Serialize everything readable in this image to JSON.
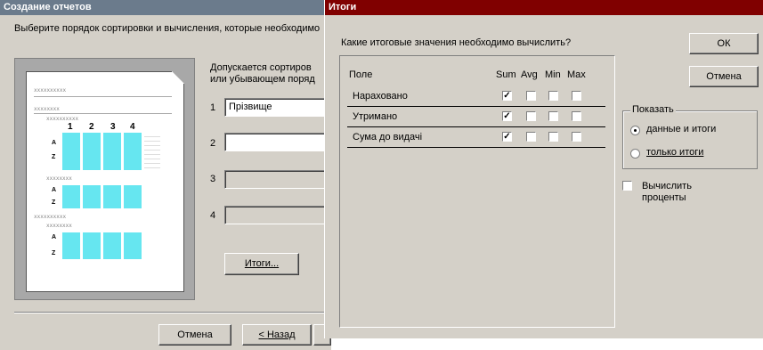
{
  "wizard": {
    "title": "Создание отчетов",
    "instruction": "Выберите порядок сортировки и вычисления, которые необходимо",
    "note_line1": "Допускается сортиров",
    "note_line2": "или убывающем поряд",
    "sort_fields": [
      {
        "number": "1",
        "value": "Прізвище"
      },
      {
        "number": "2",
        "value": ""
      },
      {
        "number": "3",
        "value": ""
      },
      {
        "number": "4",
        "value": ""
      }
    ],
    "totals_button": "Итоги...",
    "cancel_button": "Отмена",
    "back_button": "< Назад",
    "preview": {
      "header_text": "xxxxxxxxxx",
      "group_text": "xxxxxxxx",
      "numbers": [
        "1",
        "2",
        "3",
        "4"
      ],
      "side_letters": [
        "A",
        "Z"
      ]
    }
  },
  "totals_dialog": {
    "title": "Итоги",
    "question": "Какие итоговые значения необходимо вычислить?",
    "column_field": "Поле",
    "columns": [
      "Sum",
      "Avg",
      "Min",
      "Max"
    ],
    "rows": [
      {
        "field": "Нараховано",
        "checked": [
          true,
          false,
          false,
          false
        ]
      },
      {
        "field": "Утримано",
        "checked": [
          true,
          false,
          false,
          false
        ]
      },
      {
        "field": "Сума до видачі",
        "checked": [
          true,
          false,
          false,
          false
        ]
      }
    ],
    "ok_button": "ОК",
    "cancel_button": "Отмена",
    "show_group": {
      "label": "Показать",
      "options": [
        {
          "label": "данные и итоги",
          "selected": true
        },
        {
          "label": "только итоги",
          "selected": false
        }
      ]
    },
    "percent_checkbox": {
      "label_line1": "Вычислить",
      "label_line2": "проценты",
      "checked": false
    }
  },
  "colors": {
    "wizard_title": "#6b7b8c",
    "totals_title": "#800000",
    "preview_accent": "#66e6f0"
  }
}
